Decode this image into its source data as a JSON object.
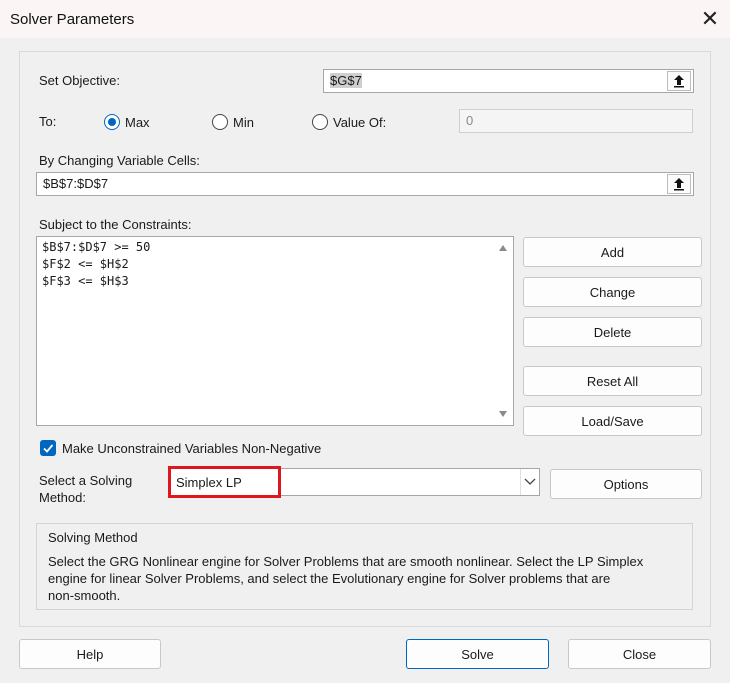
{
  "window": {
    "title": "Solver Parameters",
    "close_glyph": "✕"
  },
  "objective": {
    "label": "Set Objective:",
    "value": "$G$7"
  },
  "to": {
    "label": "To:",
    "options": [
      {
        "label": "Max",
        "checked": true
      },
      {
        "label": "Min",
        "checked": false
      },
      {
        "label": "Value Of:",
        "checked": false
      }
    ],
    "value_of_value": "0"
  },
  "changing_cells": {
    "label": "By Changing Variable Cells:",
    "value": "$B$7:$D$7"
  },
  "constraints": {
    "label": "Subject to the Constraints:",
    "items": [
      "$B$7:$D$7 >= 50",
      "$F$2 <= $H$2",
      "$F$3 <= $H$3"
    ]
  },
  "constraint_buttons": {
    "add": "Add",
    "change": "Change",
    "delete": "Delete",
    "reset_all": "Reset All",
    "load_save": "Load/Save"
  },
  "nonnegative": {
    "label": "Make Unconstrained Variables Non-Negative",
    "checked": true
  },
  "solving_method": {
    "label_line1": "Select a Solving",
    "label_line2": "Method:",
    "selected": "Simplex LP",
    "options_button": "Options"
  },
  "info": {
    "title": "Solving Method",
    "line1": "Select the GRG Nonlinear engine for Solver Problems that are smooth nonlinear. Select the LP Simplex",
    "line2": "engine for linear Solver Problems, and select the Evolutionary engine for Solver problems that are",
    "line3": "non-smooth."
  },
  "footer": {
    "help": "Help",
    "solve": "Solve",
    "close": "Close"
  },
  "colors": {
    "accent": "#0067c0",
    "highlight": "#e0161f"
  }
}
